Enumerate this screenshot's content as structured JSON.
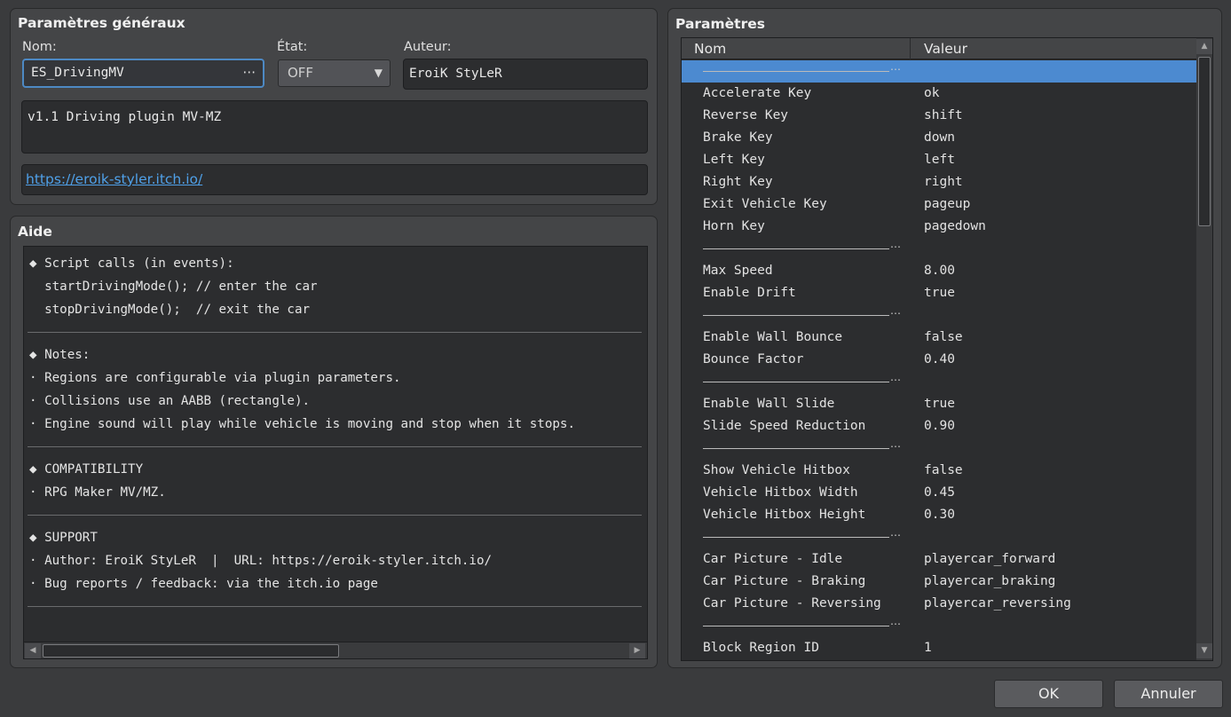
{
  "general": {
    "title": "Paramètres généraux",
    "name_label": "Nom:",
    "name_value": "ES_DrivingMV",
    "name_dots": "⋯",
    "state_label": "État:",
    "state_value": "OFF",
    "author_label": "Auteur:",
    "author_value": "EroiK StyLeR",
    "description": "v1.1 Driving plugin MV-MZ",
    "url": "https://eroik-styler.itch.io/"
  },
  "help": {
    "title": "Aide",
    "blocks": [
      [
        "◆ Script calls (in events):",
        "  startDrivingMode(); // enter the car",
        "  stopDrivingMode();  // exit the car"
      ],
      [
        "◆ Notes:",
        "· Regions are configurable via plugin parameters.",
        "· Collisions use an AABB (rectangle).",
        "· Engine sound will play while vehicle is moving and stop when it stops."
      ],
      [
        "◆ COMPATIBILITY",
        "· RPG Maker MV/MZ."
      ],
      [
        "◆ SUPPORT",
        "· Author: EroiK StyLeR  |  URL: https://eroik-styler.itch.io/",
        "· Bug reports / feedback: via the itch.io page"
      ]
    ]
  },
  "params": {
    "title": "Paramètres",
    "col_name": "Nom",
    "col_value": "Valeur",
    "sep_dots": "⋯",
    "rows": [
      {
        "sep": true,
        "selected": true
      },
      {
        "key": "Accelerate Key",
        "value": "ok"
      },
      {
        "key": "Reverse Key",
        "value": "shift"
      },
      {
        "key": "Brake Key",
        "value": "down"
      },
      {
        "key": "Left Key",
        "value": "left"
      },
      {
        "key": "Right Key",
        "value": "right"
      },
      {
        "key": "Exit Vehicle Key",
        "value": "pageup"
      },
      {
        "key": "Horn Key",
        "value": "pagedown"
      },
      {
        "sep": true
      },
      {
        "key": "Max Speed",
        "value": "8.00"
      },
      {
        "key": "Enable Drift",
        "value": "true"
      },
      {
        "sep": true
      },
      {
        "key": "Enable Wall Bounce",
        "value": "false"
      },
      {
        "key": "Bounce Factor",
        "value": "0.40"
      },
      {
        "sep": true
      },
      {
        "key": "Enable Wall Slide",
        "value": "true"
      },
      {
        "key": "Slide Speed Reduction",
        "value": "0.90"
      },
      {
        "sep": true
      },
      {
        "key": "Show Vehicle Hitbox",
        "value": "false"
      },
      {
        "key": "Vehicle Hitbox Width",
        "value": "0.45"
      },
      {
        "key": "Vehicle Hitbox Height",
        "value": "0.30"
      },
      {
        "sep": true
      },
      {
        "key": "Car Picture - Idle",
        "value": "playercar_forward"
      },
      {
        "key": "Car Picture - Braking",
        "value": "playercar_braking"
      },
      {
        "key": "Car Picture - Reversing",
        "value": "playercar_reversing"
      },
      {
        "sep": true
      },
      {
        "key": "Block Region ID",
        "value": "1"
      }
    ]
  },
  "buttons": {
    "ok": "OK",
    "cancel": "Annuler"
  },
  "scroll_icons": {
    "left": "◀",
    "right": "▶",
    "up": "▲",
    "down": "▼",
    "combo": "▼"
  }
}
